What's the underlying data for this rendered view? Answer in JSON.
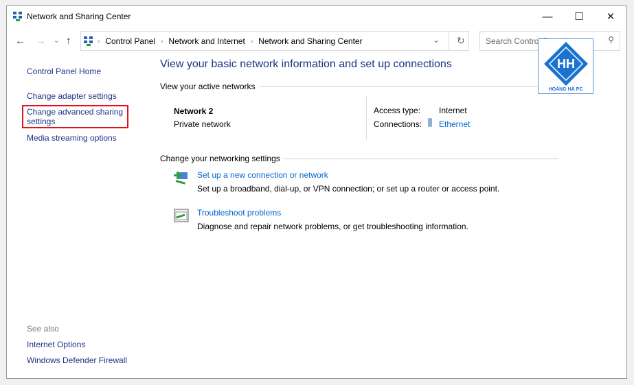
{
  "window": {
    "title": "Network and Sharing Center",
    "minimize": "—",
    "maximize": "☐",
    "close": "✕"
  },
  "address": {
    "crumbs": [
      "Control Panel",
      "Network and Internet",
      "Network and Sharing Center"
    ],
    "search_placeholder": "Search Control Panel"
  },
  "sidebar": {
    "home": "Control Panel Home",
    "items": [
      "Change adapter settings",
      "Change advanced sharing settings",
      "Media streaming options"
    ],
    "see_also": "See also",
    "see_also_items": [
      "Internet Options",
      "Windows Defender Firewall"
    ]
  },
  "main": {
    "title": "View your basic network information and set up connections",
    "active_networks": "View your active networks",
    "network_name": "Network 2",
    "network_type": "Private network",
    "access_type_label": "Access type:",
    "access_type": "Internet",
    "connections_label": "Connections:",
    "connection": "Ethernet",
    "change_settings": "Change your networking settings",
    "tasks": [
      {
        "title": "Set up a new connection or network",
        "desc": "Set up a broadband, dial-up, or VPN connection; or set up a router or access point."
      },
      {
        "title": "Troubleshoot problems",
        "desc": "Diagnose and repair network problems, or get troubleshooting information."
      }
    ]
  },
  "watermark": {
    "text": "HOÀNG HÀ PC"
  }
}
